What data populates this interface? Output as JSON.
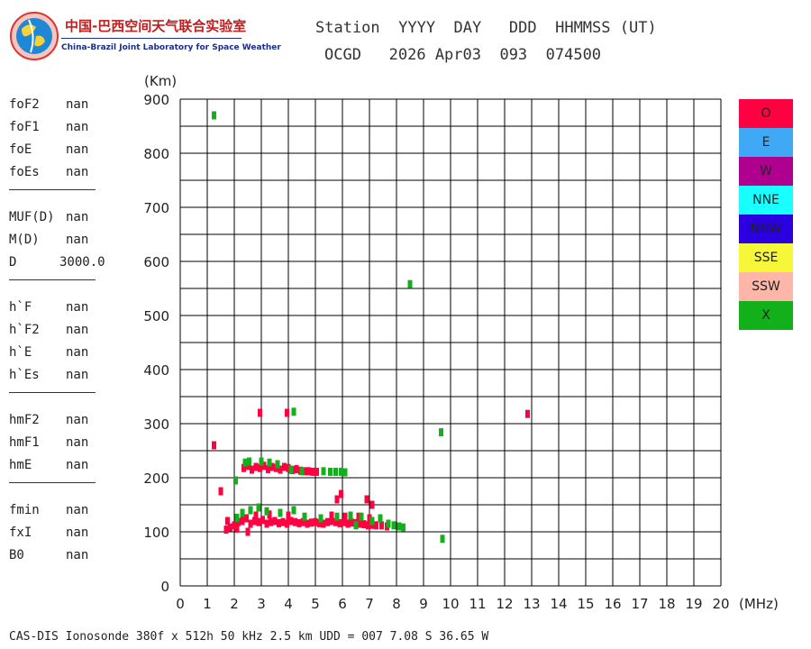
{
  "logo": {
    "cn_text": "中国-巴西空间天气联合实验室",
    "en_text": "China-Brazil Joint Laboratory for Space Weather"
  },
  "header": {
    "line1": "Station  YYYY  DAY   DDD  HHMMSS (UT)",
    "line2": "OCGD   2026 Apr03  093  074500"
  },
  "params": [
    [
      {
        "label": "foF2",
        "value": "nan"
      },
      {
        "label": "foF1",
        "value": "nan"
      },
      {
        "label": "foE",
        "value": "nan"
      },
      {
        "label": "foEs",
        "value": "nan"
      }
    ],
    [
      {
        "label": "MUF(D)",
        "value": "nan"
      },
      {
        "label": "M(D)",
        "value": "nan"
      },
      {
        "label": "D",
        "value": "3000.0"
      }
    ],
    [
      {
        "label": "h`F",
        "value": "nan"
      },
      {
        "label": "h`F2",
        "value": "nan"
      },
      {
        "label": "h`E",
        "value": "nan"
      },
      {
        "label": "h`Es",
        "value": "nan"
      }
    ],
    [
      {
        "label": "hmF2",
        "value": "nan"
      },
      {
        "label": "hmF1",
        "value": "nan"
      },
      {
        "label": "hmE",
        "value": "nan"
      }
    ],
    [
      {
        "label": "fmin",
        "value": "nan"
      },
      {
        "label": "fxI",
        "value": "nan"
      },
      {
        "label": "B0",
        "value": "nan"
      }
    ]
  ],
  "legend": [
    {
      "label": "O",
      "color": "#ff0040"
    },
    {
      "label": "E",
      "color": "#3fa9f5"
    },
    {
      "label": "W",
      "color": "#b0008f"
    },
    {
      "label": "NNE",
      "color": "#19ffff"
    },
    {
      "label": "NNW",
      "color": "#2a00e0"
    },
    {
      "label": "SSE",
      "color": "#f7f73a"
    },
    {
      "label": "SSW",
      "color": "#ffb6a8"
    },
    {
      "label": "X",
      "color": "#12b01a"
    }
  ],
  "chart_data": {
    "type": "scatter",
    "title": "",
    "xlabel": "(MHz)",
    "ylabel": "(Km)",
    "xlim": [
      0,
      20
    ],
    "ylim": [
      0,
      900
    ],
    "x_ticks": [
      "0",
      "1",
      "2",
      "3",
      "4",
      "5",
      "6",
      "7",
      "8",
      "9",
      "10",
      "11",
      "12",
      "13",
      "14",
      "15",
      "16",
      "17",
      "18",
      "19",
      "20"
    ],
    "y_ticks": [
      "0",
      "100",
      "200",
      "300",
      "400",
      "500",
      "600",
      "700",
      "800",
      "900"
    ],
    "grid": true,
    "legend_position": "right",
    "series": [
      {
        "name": "O",
        "color": "#ff0040",
        "points": [
          [
            1.25,
            260
          ],
          [
            1.5,
            175
          ],
          [
            2.95,
            320
          ],
          [
            3.95,
            320
          ],
          [
            5.95,
            170
          ],
          [
            5.8,
            160
          ],
          [
            6.9,
            160
          ],
          [
            7.1,
            150
          ],
          [
            12.85,
            318
          ],
          [
            2.35,
            218
          ],
          [
            2.5,
            222
          ],
          [
            2.65,
            215
          ],
          [
            2.8,
            220
          ],
          [
            2.95,
            218
          ],
          [
            3.1,
            222
          ],
          [
            3.25,
            216
          ],
          [
            3.4,
            220
          ],
          [
            3.55,
            218
          ],
          [
            3.7,
            215
          ],
          [
            3.85,
            220
          ],
          [
            4.0,
            218
          ],
          [
            4.15,
            214
          ],
          [
            4.3,
            216
          ],
          [
            4.45,
            213
          ],
          [
            4.6,
            212
          ],
          [
            4.75,
            212
          ],
          [
            4.9,
            211
          ],
          [
            5.05,
            211
          ],
          [
            1.7,
            104
          ],
          [
            1.85,
            108
          ],
          [
            2.0,
            112
          ],
          [
            2.15,
            118
          ],
          [
            2.3,
            120
          ],
          [
            2.45,
            125
          ],
          [
            2.6,
            115
          ],
          [
            2.75,
            120
          ],
          [
            2.9,
            118
          ],
          [
            3.05,
            122
          ],
          [
            3.2,
            115
          ],
          [
            3.35,
            118
          ],
          [
            3.5,
            120
          ],
          [
            3.65,
            116
          ],
          [
            3.8,
            118
          ],
          [
            3.95,
            115
          ],
          [
            4.1,
            120
          ],
          [
            4.25,
            118
          ],
          [
            4.4,
            116
          ],
          [
            4.55,
            118
          ],
          [
            4.7,
            115
          ],
          [
            4.85,
            117
          ],
          [
            5.0,
            118
          ],
          [
            5.15,
            116
          ],
          [
            5.3,
            115
          ],
          [
            5.45,
            118
          ],
          [
            5.6,
            120
          ],
          [
            5.75,
            118
          ],
          [
            5.9,
            116
          ],
          [
            6.05,
            118
          ],
          [
            6.2,
            115
          ],
          [
            6.35,
            117
          ],
          [
            6.5,
            116
          ],
          [
            6.65,
            115
          ],
          [
            6.8,
            114
          ],
          [
            6.95,
            112
          ],
          [
            7.1,
            113
          ],
          [
            7.25,
            112
          ],
          [
            7.45,
            112
          ],
          [
            7.65,
            110
          ],
          [
            2.1,
            106
          ],
          [
            2.8,
            130
          ],
          [
            3.3,
            132
          ],
          [
            4.0,
            130
          ],
          [
            5.6,
            130
          ],
          [
            6.1,
            128
          ],
          [
            6.6,
            128
          ],
          [
            7.0,
            125
          ],
          [
            1.75,
            120
          ],
          [
            2.5,
            100
          ]
        ]
      },
      {
        "name": "X",
        "color": "#12b01a",
        "points": [
          [
            1.25,
            870
          ],
          [
            8.5,
            558
          ],
          [
            4.2,
            322
          ],
          [
            9.65,
            284
          ],
          [
            9.7,
            87
          ],
          [
            2.05,
            195
          ],
          [
            2.4,
            228
          ],
          [
            2.55,
            230
          ],
          [
            3.0,
            230
          ],
          [
            3.3,
            228
          ],
          [
            3.6,
            225
          ],
          [
            4.1,
            215
          ],
          [
            4.5,
            212
          ],
          [
            5.3,
            212
          ],
          [
            5.55,
            211
          ],
          [
            5.75,
            211
          ],
          [
            5.95,
            211
          ],
          [
            6.1,
            210
          ],
          [
            2.1,
            126
          ],
          [
            2.3,
            135
          ],
          [
            2.6,
            140
          ],
          [
            2.9,
            145
          ],
          [
            3.2,
            138
          ],
          [
            3.7,
            135
          ],
          [
            4.2,
            140
          ],
          [
            4.6,
            128
          ],
          [
            5.2,
            125
          ],
          [
            5.8,
            128
          ],
          [
            6.3,
            130
          ],
          [
            6.7,
            128
          ],
          [
            7.1,
            120
          ],
          [
            7.4,
            125
          ],
          [
            7.7,
            115
          ],
          [
            7.9,
            112
          ],
          [
            8.1,
            110
          ],
          [
            8.25,
            108
          ],
          [
            6.5,
            112
          ]
        ]
      }
    ]
  },
  "footer": "CAS-DIS Ionosonde 380f x 512h 50 kHz 2.5 km UDD = 007 7.08 S 36.65 W"
}
